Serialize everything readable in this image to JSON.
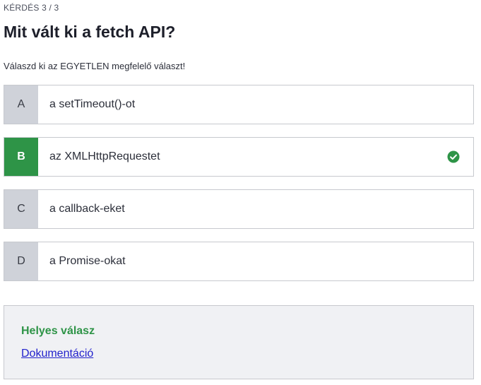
{
  "header": {
    "counter": "KÉRDÉS 3 / 3",
    "question": "Mit vált ki a fetch API?",
    "instruction": "Válaszd ki az EGYETLEN megfelelő választ!"
  },
  "answers": [
    {
      "letter": "A",
      "text": "a setTimeout()-ot",
      "correct": false
    },
    {
      "letter": "B",
      "text": "az XMLHttpRequestet",
      "correct": true
    },
    {
      "letter": "C",
      "text": "a callback-eket",
      "correct": false
    },
    {
      "letter": "D",
      "text": "a Promise-okat",
      "correct": false
    }
  ],
  "feedback": {
    "title": "Helyes válasz",
    "link_label": "Dokumentáció"
  },
  "colors": {
    "correct": "#2e9447",
    "letter_bg": "#cfd2d9",
    "link": "#2222cc"
  },
  "icons": {
    "correct_marker": "check-circle-icon"
  }
}
